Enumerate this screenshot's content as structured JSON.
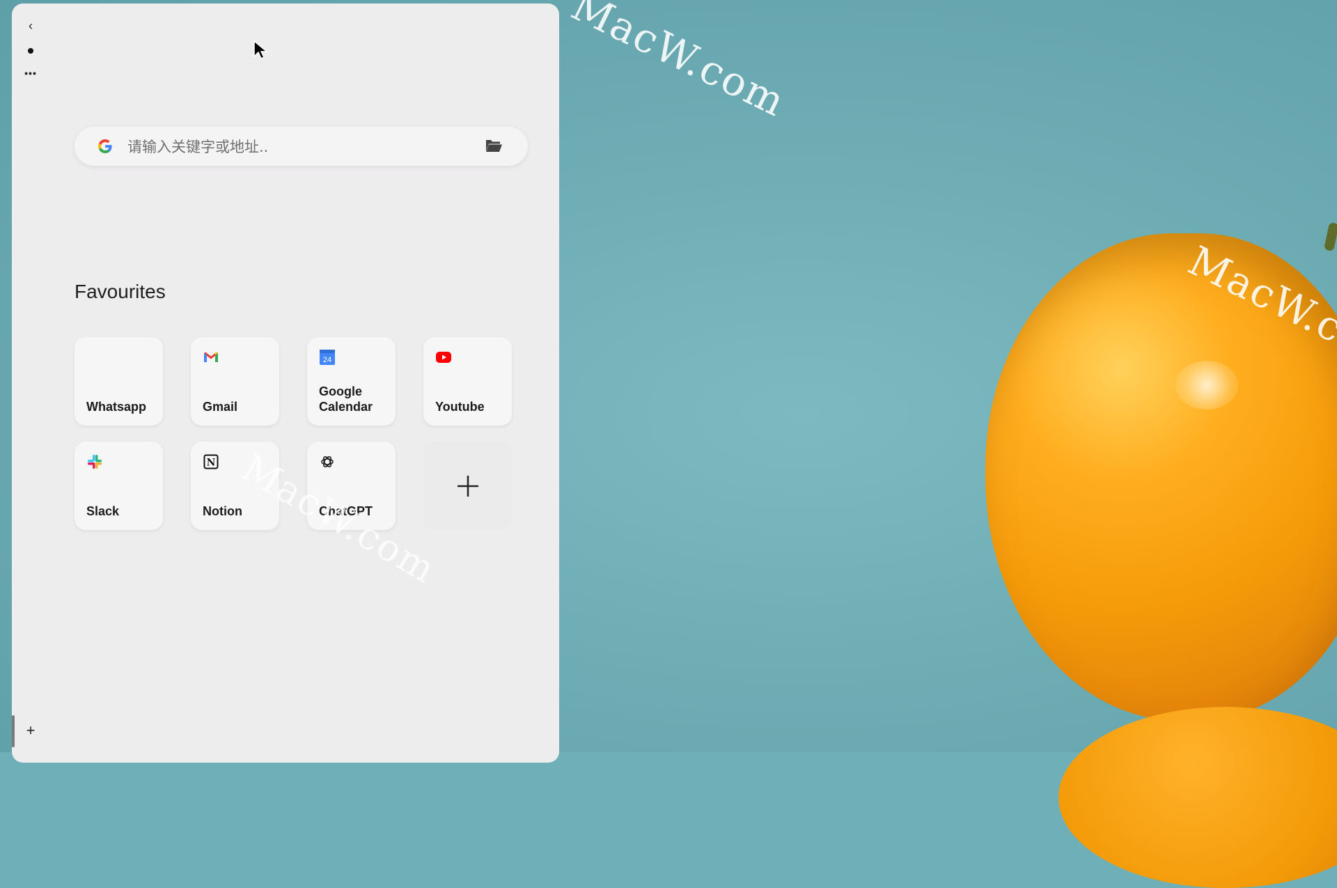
{
  "nav": {
    "back_glyph": "‹",
    "more_glyph": "•••",
    "add_glyph": "+"
  },
  "search": {
    "placeholder": "请输入关键字或地址..",
    "value": ""
  },
  "favourites": {
    "title": "Favourites",
    "items": [
      {
        "label": "Whatsapp",
        "icon": "whatsapp-icon"
      },
      {
        "label": "Gmail",
        "icon": "gmail-icon"
      },
      {
        "label": "Google Calendar",
        "icon": "google-calendar-icon",
        "icon_text": "24"
      },
      {
        "label": "Youtube",
        "icon": "youtube-icon"
      },
      {
        "label": "Slack",
        "icon": "slack-icon"
      },
      {
        "label": "Notion",
        "icon": "notion-icon",
        "icon_text": "N"
      },
      {
        "label": "ChatGPT",
        "icon": "chatgpt-icon"
      }
    ],
    "add_icon": "plus-icon"
  },
  "watermark": "MacW.com",
  "colors": {
    "panel": "#eeedee",
    "wallpaper": "#6fb0b8",
    "youtube_red": "#ff0000",
    "calendar_blue": "#4285f4"
  }
}
